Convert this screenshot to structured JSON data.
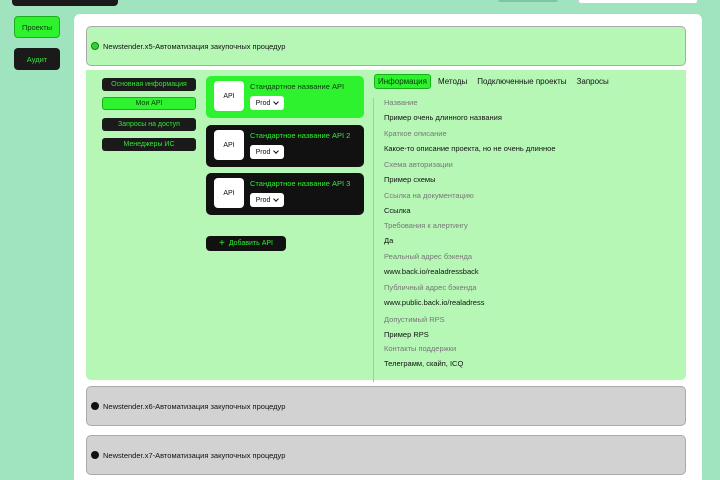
{
  "nav": {
    "projects": "Проекты",
    "audit": "Аудит"
  },
  "projects": [
    {
      "title": "Newstender.x5-Автоматизация закупочных процедур",
      "expanded": true
    },
    {
      "title": "Newstender.x6-Автоматизация закупочных процедур",
      "expanded": false
    },
    {
      "title": "Newstender.x7-Автоматизация закупочных процедур",
      "expanded": false
    }
  ],
  "subnav": [
    "Основная информация",
    "Мои API",
    "Запросы на доступ",
    "Менеджеры ИС"
  ],
  "apis": [
    {
      "icon": "API",
      "name": "Стандартное название API",
      "env": "Prod"
    },
    {
      "icon": "API",
      "name": "Стандартное название API 2",
      "env": "Prod"
    },
    {
      "icon": "API",
      "name": "Стандартное название API 3",
      "env": "Prod"
    }
  ],
  "add_api": "Добавить API",
  "tabs": [
    "Информация",
    "Методы",
    "Подключенные проекты",
    "Запросы"
  ],
  "fields": [
    {
      "label": "Название",
      "value": "Пример очень длинного названия"
    },
    {
      "label": "Краткое описание",
      "value": "Какое-то описание проекта, но не очень длинное"
    },
    {
      "label": "Схема авторизации",
      "value": "Пример схемы"
    },
    {
      "label": "Ссылка на документацию",
      "value": "Ссылка"
    },
    {
      "label": "Требования к алертингу",
      "value": "Да"
    },
    {
      "label": "Реальный адрес бэкенда",
      "value": "www.back.io/realadressback"
    },
    {
      "label": "Публичный адрес бэкенда",
      "value": "www.public.back.io/realadress"
    },
    {
      "label": "Допустимый RPS",
      "value": "Пример RPS"
    },
    {
      "label": "Контакты поддержки",
      "value": "Телеграмм, скайп, ICQ"
    }
  ],
  "colors": {
    "background": "#9fe3bf",
    "accent": "#2df22d",
    "dark": "#111111",
    "card_green": "#b6f7b6",
    "card_grey": "#d2d2d2"
  }
}
